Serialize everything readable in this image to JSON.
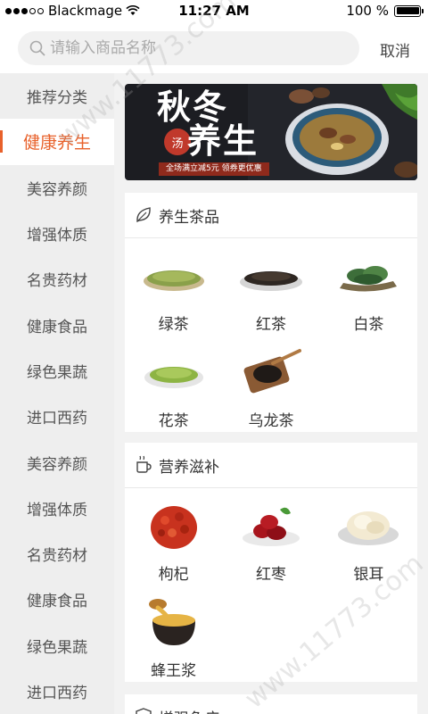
{
  "status_bar": {
    "carrier": "Blackmage",
    "time": "11:27 AM",
    "battery": "100 %",
    "battery_level": 1.0
  },
  "search": {
    "placeholder": "请输入商品名称",
    "cancel_label": "取消"
  },
  "sidebar": {
    "items": [
      {
        "label": "推荐分类",
        "active": false
      },
      {
        "label": "健康养生",
        "active": true
      },
      {
        "label": "美容养颜",
        "active": false
      },
      {
        "label": "增强体质",
        "active": false
      },
      {
        "label": "名贵药材",
        "active": false
      },
      {
        "label": "健康食品",
        "active": false
      },
      {
        "label": "绿色果蔬",
        "active": false
      },
      {
        "label": "进口西药",
        "active": false
      },
      {
        "label": "美容养颜",
        "active": false
      },
      {
        "label": "增强体质",
        "active": false
      },
      {
        "label": "名贵药材",
        "active": false
      },
      {
        "label": "健康食品",
        "active": false
      },
      {
        "label": "绿色果蔬",
        "active": false
      },
      {
        "label": "进口西药",
        "active": false
      }
    ]
  },
  "banner": {
    "title_line1": "秋冬",
    "seal": "汤",
    "title_line2": "养生",
    "promo": "全场满立减5元 领券更优惠"
  },
  "sections": [
    {
      "title": "养生茶品",
      "icon": "leaf-icon",
      "items": [
        {
          "label": "绿茶",
          "icon": "green-tea"
        },
        {
          "label": "红茶",
          "icon": "black-tea"
        },
        {
          "label": "白茶",
          "icon": "white-tea"
        },
        {
          "label": "花茶",
          "icon": "flower-tea"
        },
        {
          "label": "乌龙茶",
          "icon": "oolong-tea"
        }
      ]
    },
    {
      "title": "营养滋补",
      "icon": "cup-icon",
      "items": [
        {
          "label": "枸杞",
          "icon": "goji"
        },
        {
          "label": "红枣",
          "icon": "jujube"
        },
        {
          "label": "银耳",
          "icon": "white-fungus"
        },
        {
          "label": "蜂王浆",
          "icon": "royal-jelly"
        }
      ]
    },
    {
      "title": "增强免疫",
      "icon": "shield-icon"
    }
  ],
  "watermark": "www.11773.com",
  "colors": {
    "accent": "#e8612b",
    "sidebar_bg": "#eeeeee",
    "page_bg": "#f2f2f2"
  }
}
